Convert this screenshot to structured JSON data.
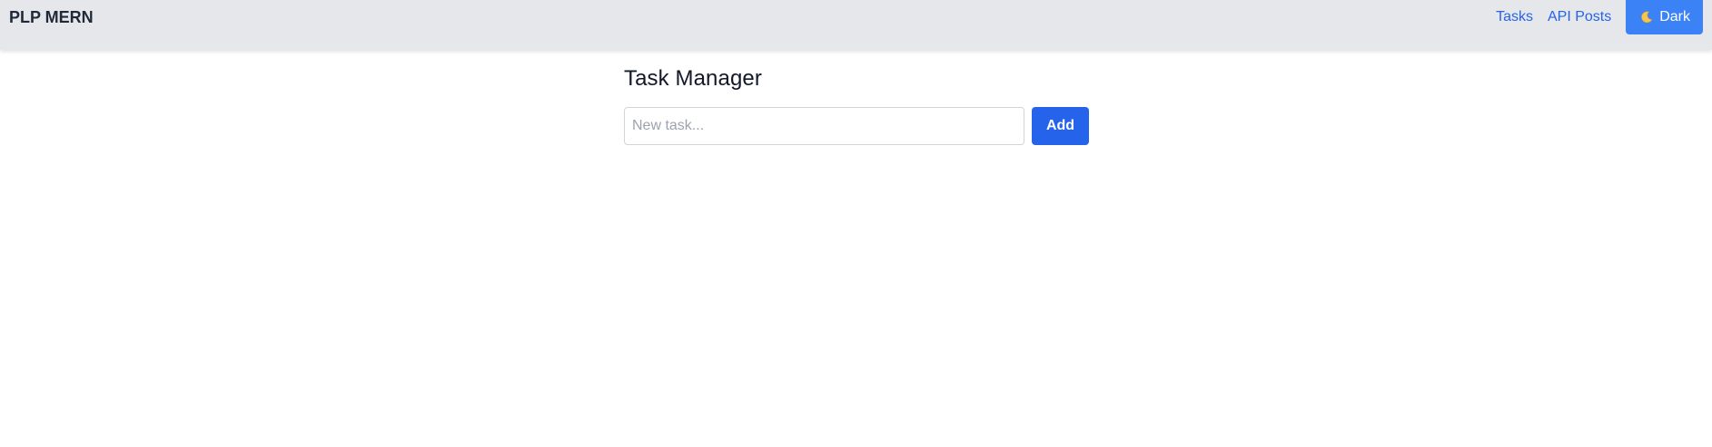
{
  "navbar": {
    "brand": "PLP MERN",
    "links": [
      {
        "label": "Tasks"
      },
      {
        "label": "API Posts"
      }
    ],
    "theme_toggle": {
      "icon": "moon-icon",
      "label": "Dark",
      "color": "#3b82f6"
    }
  },
  "main": {
    "title": "Task Manager",
    "task_input": {
      "placeholder": "New task...",
      "value": ""
    },
    "add_button_label": "Add"
  },
  "colors": {
    "navbar_bg": "#e5e7eb",
    "link": "#2563eb",
    "primary_button": "#2563eb"
  }
}
